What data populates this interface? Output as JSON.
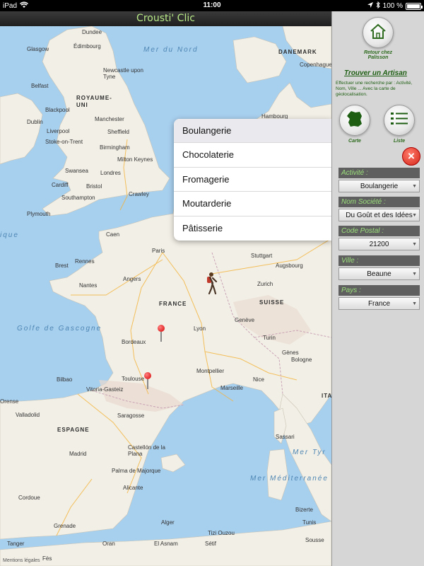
{
  "status": {
    "carrier": "iPad",
    "time": "11:00",
    "battery": "100 %"
  },
  "app": {
    "title": "Crousti' Clic"
  },
  "map": {
    "labels": {
      "glasgow": "Glasgow",
      "edimbourg": "Édimbourg",
      "dundee": "Dundee",
      "mer_du_nord": "Mer du Nord",
      "newcastle": "Newcastle upon Tyne",
      "belfast": "Belfast",
      "royaume_uni": "ROYAUME-UNI",
      "blackpool": "Blackpool",
      "dublin": "Dublin",
      "liverpool": "Liverpool",
      "manchester": "Manchester",
      "sheffield": "Sheffield",
      "stoke": "Stoke-on-Trent",
      "birmingham": "Birmingham",
      "swansea": "Swansea",
      "milton": "Milton Keynes",
      "cardiff": "Cardiff",
      "londres": "Londres",
      "bristol": "Bristol",
      "southampton": "Southampton",
      "crawley": "Crawley",
      "plymouth": "Plymouth",
      "denmark": "DANEMARK",
      "copenhague": "Copenhague",
      "hambourg": "Hambourg",
      "iq": "ique",
      "caen": "Caen",
      "paris": "Paris",
      "rennes": "Rennes",
      "brest": "Brest",
      "angers": "Angers",
      "nantes": "Nantes",
      "france": "FRANCE",
      "stuttgart": "Stuttgart",
      "augsbourg": "Augsbourg",
      "suisse": "SUISSE",
      "zurich": "Zurich",
      "geneve": "Genève",
      "lyon": "Lyon",
      "turin": "Turin",
      "golfe": "Golfe de Gascogne",
      "bordeaux": "Bordeaux",
      "genes": "Gènes",
      "bologne": "Bologne",
      "bilbao": "Bilbao",
      "toulouse": "Toulouse",
      "montpellier": "Montpellier",
      "nice": "Nice",
      "vitoria": "Vitoria-Gasteiz",
      "marseille": "Marseille",
      "orense": "Orense",
      "valladolid": "Valladolid",
      "saragosse": "Saragosse",
      "espagne": "ESPAGNE",
      "madrid": "Madrid",
      "castellon": "Castellón de la Plana",
      "palma": "Palma de Majorque",
      "sassari": "Sassari",
      "mer_tyr": "Mer Tyr",
      "merra": "Mer Méditerranée",
      "cordoue": "Cordoue",
      "alicante": "Alicante",
      "grenade": "Grenade",
      "alger": "Alger",
      "bizerte": "Bizerte",
      "tunis": "Tunis",
      "tanger": "Tanger",
      "oran": "Oran",
      "tizi": "Tizi Ouzou",
      "sousse": "Sousse",
      "fes": "Fès",
      "asnam": "El Asnam",
      "setif": "Sétif",
      "ita": "ITA",
      "legal": "Mentions légales"
    }
  },
  "popover": {
    "items": [
      "Boulangerie",
      "Chocolaterie",
      "Fromagerie",
      "Moutarderie",
      "Pâtisserie"
    ],
    "selected_index": 0
  },
  "panel": {
    "home_label": "Retour chez Palisson",
    "find_title": "Trouver un Artisan",
    "help_text": "Effectuer une recherche par : Activité, Nom, Ville ... Avec la carte de géolocalisation.",
    "map_label": "Carte",
    "list_label": "Liste",
    "fields": {
      "activite": {
        "label": "Activité :",
        "value": "Boulangerie"
      },
      "societe": {
        "label": "Nom Société :",
        "value": "Du Goût et des Idées"
      },
      "code_postal": {
        "label": "Code Postal :",
        "value": "21200"
      },
      "ville": {
        "label": "Ville :",
        "value": "Beaune"
      },
      "pays": {
        "label": "Pays :",
        "value": "France"
      }
    }
  },
  "colors": {
    "accent_green": "#1d5e12",
    "title_green": "#b8e986",
    "map_water": "#a7cfee",
    "map_land": "#f2efe6"
  },
  "icons": {
    "home": "home-icon",
    "france_map": "france-map-icon",
    "list": "list-icon",
    "close": "close-icon",
    "caret": "caret-down-icon",
    "pin": "map-pin-icon",
    "hiker": "hiker-icon"
  }
}
